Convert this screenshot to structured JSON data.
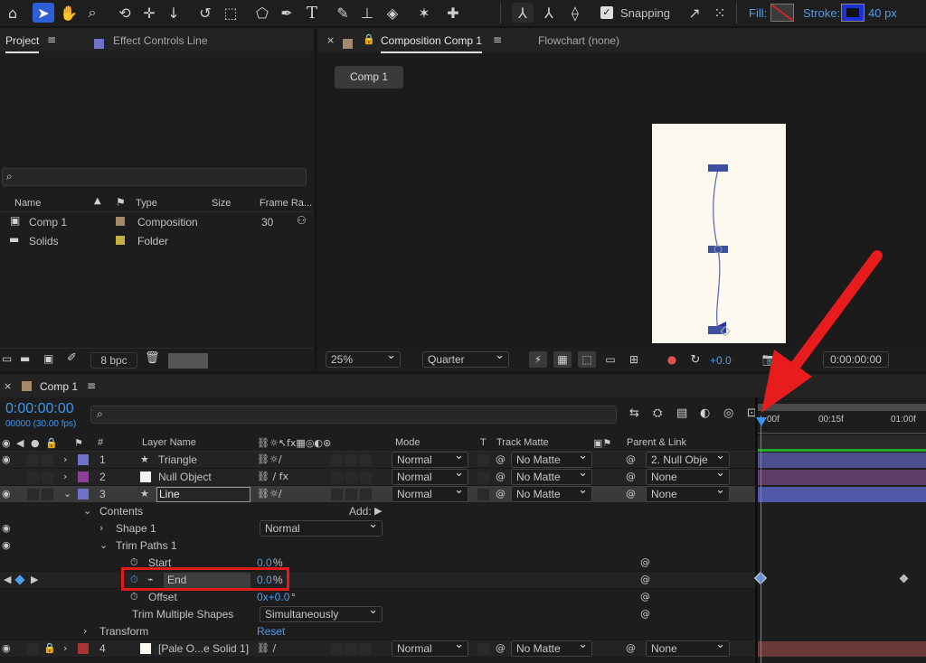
{
  "toolbar": {
    "snapping_label": "Snapping",
    "fill_label": "Fill:",
    "stroke_label": "Stroke:",
    "stroke_width": "40 px"
  },
  "project_panel": {
    "tab_project": "Project",
    "tab_effect_controls": "Effect Controls Line",
    "search_placeholder": "",
    "columns": [
      "Name",
      "Type",
      "Size",
      "Frame Ra..."
    ],
    "items": [
      {
        "name": "Comp 1",
        "type": "Composition",
        "size": "",
        "frame_rate": "30",
        "color": "#a48a6a"
      },
      {
        "name": "Solids",
        "type": "Folder",
        "size": "",
        "frame_rate": "",
        "color": "#c8b040"
      }
    ],
    "bpc": "8 bpc"
  },
  "comp_panel": {
    "tab_composition": "Composition Comp 1",
    "tab_flowchart": "Flowchart (none)",
    "breadcrumb": "Comp 1",
    "zoom": "25%",
    "resolution": "Quarter",
    "exposure": "+0.0",
    "timecode": "0:00:00:00"
  },
  "timeline": {
    "tab": "Comp 1",
    "timecode": "0:00:00:00",
    "frame_info": "00000 (30.00 fps)",
    "ruler": [
      "00f",
      "00:15f",
      "01:00f"
    ],
    "headers": {
      "num": "#",
      "layer_name": "Layer Name",
      "mode": "Mode",
      "t": "T",
      "track_matte": "Track Matte",
      "parent": "Parent & Link"
    },
    "layers": [
      {
        "num": "1",
        "name": "Triangle",
        "mode": "Normal",
        "matte": "No Matte",
        "parent": "2. Null Obje",
        "color": "#6f72c8"
      },
      {
        "num": "2",
        "name": "Null Object",
        "mode": "Normal",
        "matte": "No Matte",
        "parent": "None",
        "color": "#8e3f9a"
      },
      {
        "num": "3",
        "name": "Line",
        "mode": "Normal",
        "matte": "No Matte",
        "parent": "None",
        "color": "#6f72c8"
      },
      {
        "num": "4",
        "name": "[Pale O...e Solid 1]",
        "mode": "Normal",
        "matte": "No Matte",
        "parent": "None",
        "color": "#a83434"
      }
    ],
    "props": {
      "contents": "Contents",
      "add": "Add:",
      "shape1": "Shape 1",
      "shape1_mode": "Normal",
      "trim_paths": "Trim Paths 1",
      "start": "Start",
      "start_value": "0.0",
      "start_unit": "%",
      "end": "End",
      "end_value": "0.0",
      "end_unit": "%",
      "offset": "Offset",
      "offset_value": "0x+0.0",
      "offset_unit": "°",
      "trim_multiple": "Trim Multiple Shapes",
      "trim_multiple_value": "Simultaneously",
      "transform": "Transform",
      "reset": "Reset"
    }
  },
  "colors": {
    "accent": "#2d8cf0",
    "highlight_box": "#e21a1a",
    "arrow": "#e81c1c",
    "canvas": "#fdf9ee"
  }
}
